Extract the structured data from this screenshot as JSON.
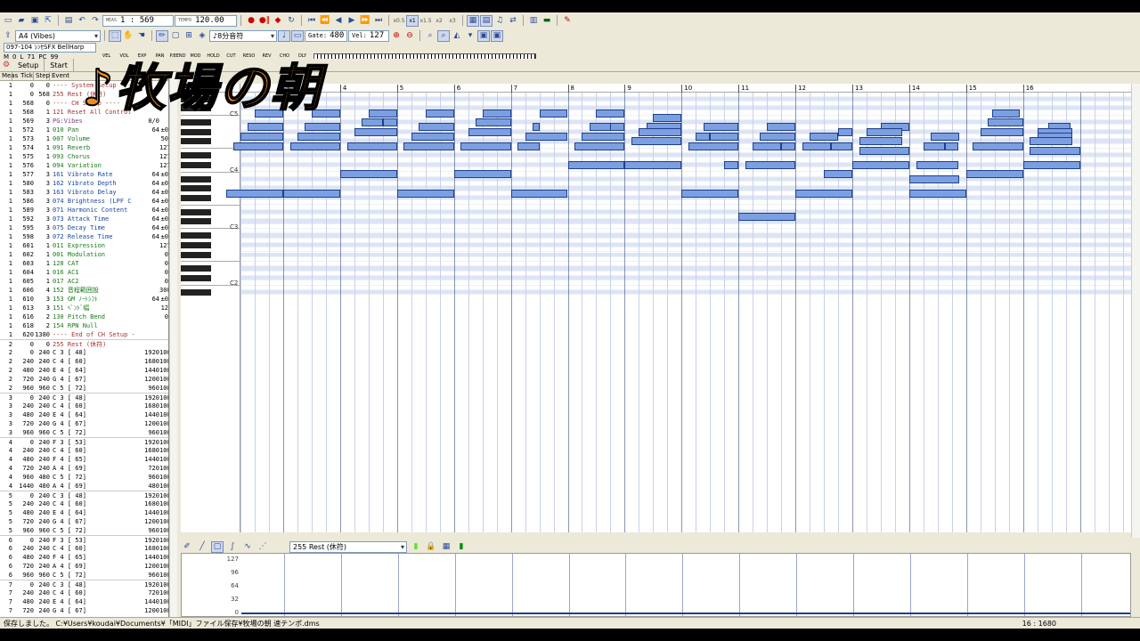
{
  "overlay_title": "♪牧場の朝",
  "toolbar": {
    "meas_label": "MEAS",
    "position": "1 : 569",
    "tempo_label": "TEMPO",
    "tempo": "120.00",
    "speeds": [
      "x0.5",
      "x1",
      "x1.5",
      "x2",
      "x3"
    ],
    "instrument": "A4  (Vibes)",
    "note_len": "8分音符",
    "gate_label": "Gate:",
    "gate": "480",
    "vel_label": "Vel:",
    "vel": "127"
  },
  "track": {
    "name": "097-104 ｼﾝｾSFX BellHarp",
    "m_label": "M",
    "m": "0",
    "l_label": "L",
    "l": "71",
    "pc_label": "PC",
    "pc": "99"
  },
  "meters": [
    {
      "label": "VEL",
      "value": "0"
    },
    {
      "label": "VOL",
      "value": "50"
    },
    {
      "label": "EXP",
      "value": "127"
    },
    {
      "label": "PAN",
      "value": "0"
    },
    {
      "label": "P.BEND",
      "value": "0"
    },
    {
      "label": "MOD",
      "value": "0"
    },
    {
      "label": "HOLD",
      "value": "0"
    },
    {
      "label": "CUT",
      "value": "0"
    },
    {
      "label": "RESO",
      "value": "0"
    },
    {
      "label": "REV",
      "value": "127"
    },
    {
      "label": "CHO",
      "value": "127"
    },
    {
      "label": "DLY",
      "value": "127"
    }
  ],
  "tabs": [
    "Setup",
    "Start"
  ],
  "event_columns": [
    "Meas",
    "Tick",
    "Step",
    "Event",
    "Gate",
    "Vel"
  ],
  "events": [
    [
      "1",
      "0",
      "0",
      "---- System Setup ----",
      "",
      ""
    ],
    [
      "1",
      "0",
      "568",
      "255 Rest (休符)",
      "",
      ""
    ],
    [
      "1",
      "568",
      "0",
      "---- CH Setup ----",
      "",
      ""
    ],
    [
      "1",
      "568",
      "1",
      "121 Reset All Control",
      "",
      ""
    ],
    [
      "1",
      "569",
      "3",
      "PG:Vibes",
      "0/0",
      ""
    ],
    [
      "1",
      "572",
      "1",
      "010 Pan",
      "64",
      "±0"
    ],
    [
      "1",
      "573",
      "1",
      "007 Volume",
      "",
      "50"
    ],
    [
      "1",
      "574",
      "1",
      "091 Reverb",
      "",
      "127"
    ],
    [
      "1",
      "575",
      "1",
      "093 Chorus",
      "",
      "127"
    ],
    [
      "1",
      "576",
      "1",
      "094 Variation",
      "",
      "127"
    ],
    [
      "1",
      "577",
      "3",
      "161 Vibrato Rate",
      "64",
      "±0"
    ],
    [
      "1",
      "580",
      "3",
      "162 Vibrato Depth",
      "64",
      "±0"
    ],
    [
      "1",
      "583",
      "3",
      "163 Vibrato Delay",
      "64",
      "±0"
    ],
    [
      "1",
      "586",
      "3",
      "074 Brightness (LPF C",
      "64",
      "±0"
    ],
    [
      "1",
      "589",
      "3",
      "071 Harmonic Content",
      "64",
      "±0"
    ],
    [
      "1",
      "592",
      "3",
      "073 Attack Time",
      "64",
      "±0"
    ],
    [
      "1",
      "595",
      "3",
      "075 Decay Time",
      "64",
      "±0"
    ],
    [
      "1",
      "598",
      "3",
      "072 Release Time",
      "64",
      "±0"
    ],
    [
      "1",
      "601",
      "1",
      "011 Expression",
      "",
      "127"
    ],
    [
      "1",
      "602",
      "1",
      "001 Modulation",
      "",
      "0"
    ],
    [
      "1",
      "603",
      "1",
      "128 CAT",
      "",
      "0"
    ],
    [
      "1",
      "604",
      "1",
      "016 AC1",
      "",
      "0"
    ],
    [
      "1",
      "605",
      "1",
      "017 AC2",
      "",
      "0"
    ],
    [
      "1",
      "606",
      "4",
      "152 音程範囲設",
      "",
      "3000"
    ],
    [
      "1",
      "610",
      "3",
      "153 GM ﾉｰﾄｼﾌﾄ",
      "64",
      "±0"
    ],
    [
      "1",
      "613",
      "3",
      "151 ﾍﾞﾝﾄﾞ幅",
      "",
      "12"
    ],
    [
      "1",
      "616",
      "2",
      "130 Pitch Bend",
      "",
      "0"
    ],
    [
      "1",
      "618",
      "2",
      "154 RPN Null",
      "",
      ""
    ],
    [
      "1",
      "620",
      "1380",
      "---- End of CH Setup ----",
      "",
      ""
    ],
    [
      "2",
      "0",
      "0",
      "255 Rest (休符)",
      "",
      ""
    ],
    [
      "2",
      "0",
      "240",
      "C 3 [ 48]",
      "1920",
      "100"
    ],
    [
      "2",
      "240",
      "240",
      "C 4 [ 60]",
      "1680",
      "100"
    ],
    [
      "2",
      "480",
      "240",
      "E 4 [ 64]",
      "1440",
      "100"
    ],
    [
      "2",
      "720",
      "240",
      "G 4 [ 67]",
      "1200",
      "100"
    ],
    [
      "2",
      "960",
      "960",
      "C 5 [ 72]",
      "960",
      "100"
    ],
    [
      "3",
      "0",
      "240",
      "C 3 [ 48]",
      "1920",
      "100"
    ],
    [
      "3",
      "240",
      "240",
      "C 4 [ 60]",
      "1680",
      "100"
    ],
    [
      "3",
      "480",
      "240",
      "E 4 [ 64]",
      "1440",
      "100"
    ],
    [
      "3",
      "720",
      "240",
      "G 4 [ 67]",
      "1200",
      "100"
    ],
    [
      "3",
      "960",
      "960",
      "C 5 [ 72]",
      "960",
      "100"
    ],
    [
      "4",
      "0",
      "240",
      "F 3 [ 53]",
      "1920",
      "100"
    ],
    [
      "4",
      "240",
      "240",
      "C 4 [ 60]",
      "1680",
      "100"
    ],
    [
      "4",
      "480",
      "240",
      "F 4 [ 65]",
      "1440",
      "100"
    ],
    [
      "4",
      "720",
      "240",
      "A 4 [ 69]",
      "720",
      "100"
    ],
    [
      "4",
      "960",
      "480",
      "C 5 [ 72]",
      "960",
      "100"
    ],
    [
      "4",
      "1440",
      "480",
      "A 4 [ 69]",
      "480",
      "100"
    ],
    [
      "5",
      "0",
      "240",
      "C 3 [ 48]",
      "1920",
      "100"
    ],
    [
      "5",
      "240",
      "240",
      "C 4 [ 60]",
      "1680",
      "100"
    ],
    [
      "5",
      "480",
      "240",
      "E 4 [ 64]",
      "1440",
      "100"
    ],
    [
      "5",
      "720",
      "240",
      "G 4 [ 67]",
      "1200",
      "100"
    ],
    [
      "5",
      "960",
      "960",
      "C 5 [ 72]",
      "960",
      "100"
    ],
    [
      "6",
      "0",
      "240",
      "F 3 [ 53]",
      "1920",
      "100"
    ],
    [
      "6",
      "240",
      "240",
      "C 4 [ 60]",
      "1680",
      "100"
    ],
    [
      "6",
      "480",
      "240",
      "F 4 [ 65]",
      "1440",
      "100"
    ],
    [
      "6",
      "720",
      "240",
      "A 4 [ 69]",
      "1200",
      "100"
    ],
    [
      "6",
      "960",
      "960",
      "C 5 [ 72]",
      "960",
      "100"
    ],
    [
      "7",
      "0",
      "240",
      "C 3 [ 48]",
      "1920",
      "100"
    ],
    [
      "7",
      "240",
      "240",
      "C 4 [ 60]",
      "720",
      "100"
    ],
    [
      "7",
      "480",
      "240",
      "E 4 [ 64]",
      "1440",
      "100"
    ],
    [
      "7",
      "720",
      "240",
      "G 4 [ 67]",
      "1200",
      "100"
    ]
  ],
  "ruler_measures": [
    "3",
    "4",
    "5",
    "6",
    "7",
    "8",
    "9",
    "10",
    "11",
    "12",
    "13",
    "14",
    "15",
    "16"
  ],
  "octave_labels": [
    "C5",
    "C4",
    "C3",
    "C2"
  ],
  "notes": [
    {
      "m": 2.5,
      "d": 0.5,
      "p": 72
    },
    {
      "m": 3.5,
      "d": 0.5,
      "p": 72
    },
    {
      "m": 4.5,
      "d": 0.5,
      "p": 72
    },
    {
      "m": 5.5,
      "d": 0.5,
      "p": 72
    },
    {
      "m": 6.5,
      "d": 0.5,
      "p": 72
    },
    {
      "m": 7.5,
      "d": 0.5,
      "p": 72
    },
    {
      "m": 8.5,
      "d": 0.5,
      "p": 72
    },
    {
      "m": 9.5,
      "d": 0.5,
      "p": 71
    },
    {
      "m": 15.45,
      "d": 0.5,
      "p": 72
    },
    {
      "m": 4.38,
      "d": 0.38,
      "p": 70
    },
    {
      "m": 4.75,
      "d": 0.25,
      "p": 70
    },
    {
      "m": 6.38,
      "d": 0.62,
      "p": 70
    },
    {
      "m": 15.38,
      "d": 0.62,
      "p": 70
    },
    {
      "m": 2.38,
      "d": 0.62,
      "p": 69
    },
    {
      "m": 3.38,
      "d": 0.62,
      "p": 69
    },
    {
      "m": 5.38,
      "d": 0.62,
      "p": 69
    },
    {
      "m": 7.38,
      "d": 0.12,
      "p": 69
    },
    {
      "m": 8.38,
      "d": 0.38,
      "p": 69
    },
    {
      "m": 8.75,
      "d": 0.25,
      "p": 69
    },
    {
      "m": 9.38,
      "d": 0.62,
      "p": 69
    },
    {
      "m": 10.38,
      "d": 0.62,
      "p": 69
    },
    {
      "m": 11.5,
      "d": 0.5,
      "p": 69
    },
    {
      "m": 13.5,
      "d": 0.5,
      "p": 69
    },
    {
      "m": 16.45,
      "d": 0.38,
      "p": 69
    },
    {
      "m": 4.25,
      "d": 0.75,
      "p": 68
    },
    {
      "m": 6.25,
      "d": 0.75,
      "p": 68
    },
    {
      "m": 9.25,
      "d": 0.75,
      "p": 68
    },
    {
      "m": 12.75,
      "d": 0.25,
      "p": 68
    },
    {
      "m": 13.25,
      "d": 0.62,
      "p": 68
    },
    {
      "m": 15.25,
      "d": 0.75,
      "p": 68
    },
    {
      "m": 16.25,
      "d": 0.62,
      "p": 68
    },
    {
      "m": 2.25,
      "d": 0.75,
      "p": 67
    },
    {
      "m": 3.25,
      "d": 0.75,
      "p": 67
    },
    {
      "m": 5.25,
      "d": 0.75,
      "p": 67
    },
    {
      "m": 7.25,
      "d": 0.75,
      "p": 67
    },
    {
      "m": 8.25,
      "d": 0.75,
      "p": 67
    },
    {
      "m": 10.25,
      "d": 0.25,
      "p": 67
    },
    {
      "m": 10.5,
      "d": 0.5,
      "p": 67
    },
    {
      "m": 11.38,
      "d": 0.62,
      "p": 67
    },
    {
      "m": 12.25,
      "d": 0.5,
      "p": 67
    },
    {
      "m": 14.38,
      "d": 0.5,
      "p": 67
    },
    {
      "m": 16.25,
      "d": 0.62,
      "p": 67
    },
    {
      "m": 9.12,
      "d": 0.88,
      "p": 66
    },
    {
      "m": 13.12,
      "d": 0.75,
      "p": 66
    },
    {
      "m": 16.12,
      "d": 0.75,
      "p": 66
    },
    {
      "m": 2.12,
      "d": 0.88,
      "p": 65
    },
    {
      "m": 3.12,
      "d": 0.88,
      "p": 65
    },
    {
      "m": 4.12,
      "d": 0.88,
      "p": 65
    },
    {
      "m": 5.12,
      "d": 0.88,
      "p": 65
    },
    {
      "m": 6.12,
      "d": 0.88,
      "p": 65
    },
    {
      "m": 7.12,
      "d": 0.38,
      "p": 65
    },
    {
      "m": 8.12,
      "d": 0.88,
      "p": 65
    },
    {
      "m": 10.12,
      "d": 0.88,
      "p": 65
    },
    {
      "m": 11.25,
      "d": 0.5,
      "p": 65
    },
    {
      "m": 11.75,
      "d": 0.25,
      "p": 65
    },
    {
      "m": 12.12,
      "d": 0.5,
      "p": 65
    },
    {
      "m": 12.62,
      "d": 0.38,
      "p": 65
    },
    {
      "m": 14.25,
      "d": 0.38,
      "p": 65
    },
    {
      "m": 14.62,
      "d": 0.25,
      "p": 65
    },
    {
      "m": 15.12,
      "d": 0.88,
      "p": 65
    },
    {
      "m": 13.12,
      "d": 0.88,
      "p": 64
    },
    {
      "m": 16.12,
      "d": 0.88,
      "p": 64
    },
    {
      "m": 8.0,
      "d": 1.0,
      "p": 61
    },
    {
      "m": 9.0,
      "d": 1.0,
      "p": 61
    },
    {
      "m": 10.75,
      "d": 0.25,
      "p": 61
    },
    {
      "m": 11.12,
      "d": 0.88,
      "p": 61
    },
    {
      "m": 13.0,
      "d": 1.0,
      "p": 61
    },
    {
      "m": 14.12,
      "d": 0.75,
      "p": 61
    },
    {
      "m": 16.0,
      "d": 1.0,
      "p": 61
    },
    {
      "m": 4.0,
      "d": 1.0,
      "p": 59
    },
    {
      "m": 6.0,
      "d": 1.0,
      "p": 59
    },
    {
      "m": 12.5,
      "d": 0.5,
      "p": 59
    },
    {
      "m": 15.0,
      "d": 1.0,
      "p": 59
    },
    {
      "m": 14.0,
      "d": 0.88,
      "p": 58
    },
    {
      "m": 2.0,
      "d": 1.0,
      "p": 55
    },
    {
      "m": 3.0,
      "d": 1.0,
      "p": 55
    },
    {
      "m": 5.0,
      "d": 1.0,
      "p": 55
    },
    {
      "m": 7.0,
      "d": 1.0,
      "p": 55
    },
    {
      "m": 10.0,
      "d": 1.0,
      "p": 55
    },
    {
      "m": 12.0,
      "d": 1.0,
      "p": 55
    },
    {
      "m": 14.0,
      "d": 1.0,
      "p": 55
    },
    {
      "m": 11.0,
      "d": 1.0,
      "p": 50
    }
  ],
  "vel_tool": {
    "event_select": "255 Rest (休符)"
  },
  "vel_scale": [
    "127",
    "96",
    "64",
    "32",
    "0"
  ],
  "status": {
    "left": "保存しました。   C:¥Users¥koudai¥Documents¥「MIDI」ファイル保存¥牧場の朝 速テンポ.dms",
    "right": "16 : 1680"
  }
}
